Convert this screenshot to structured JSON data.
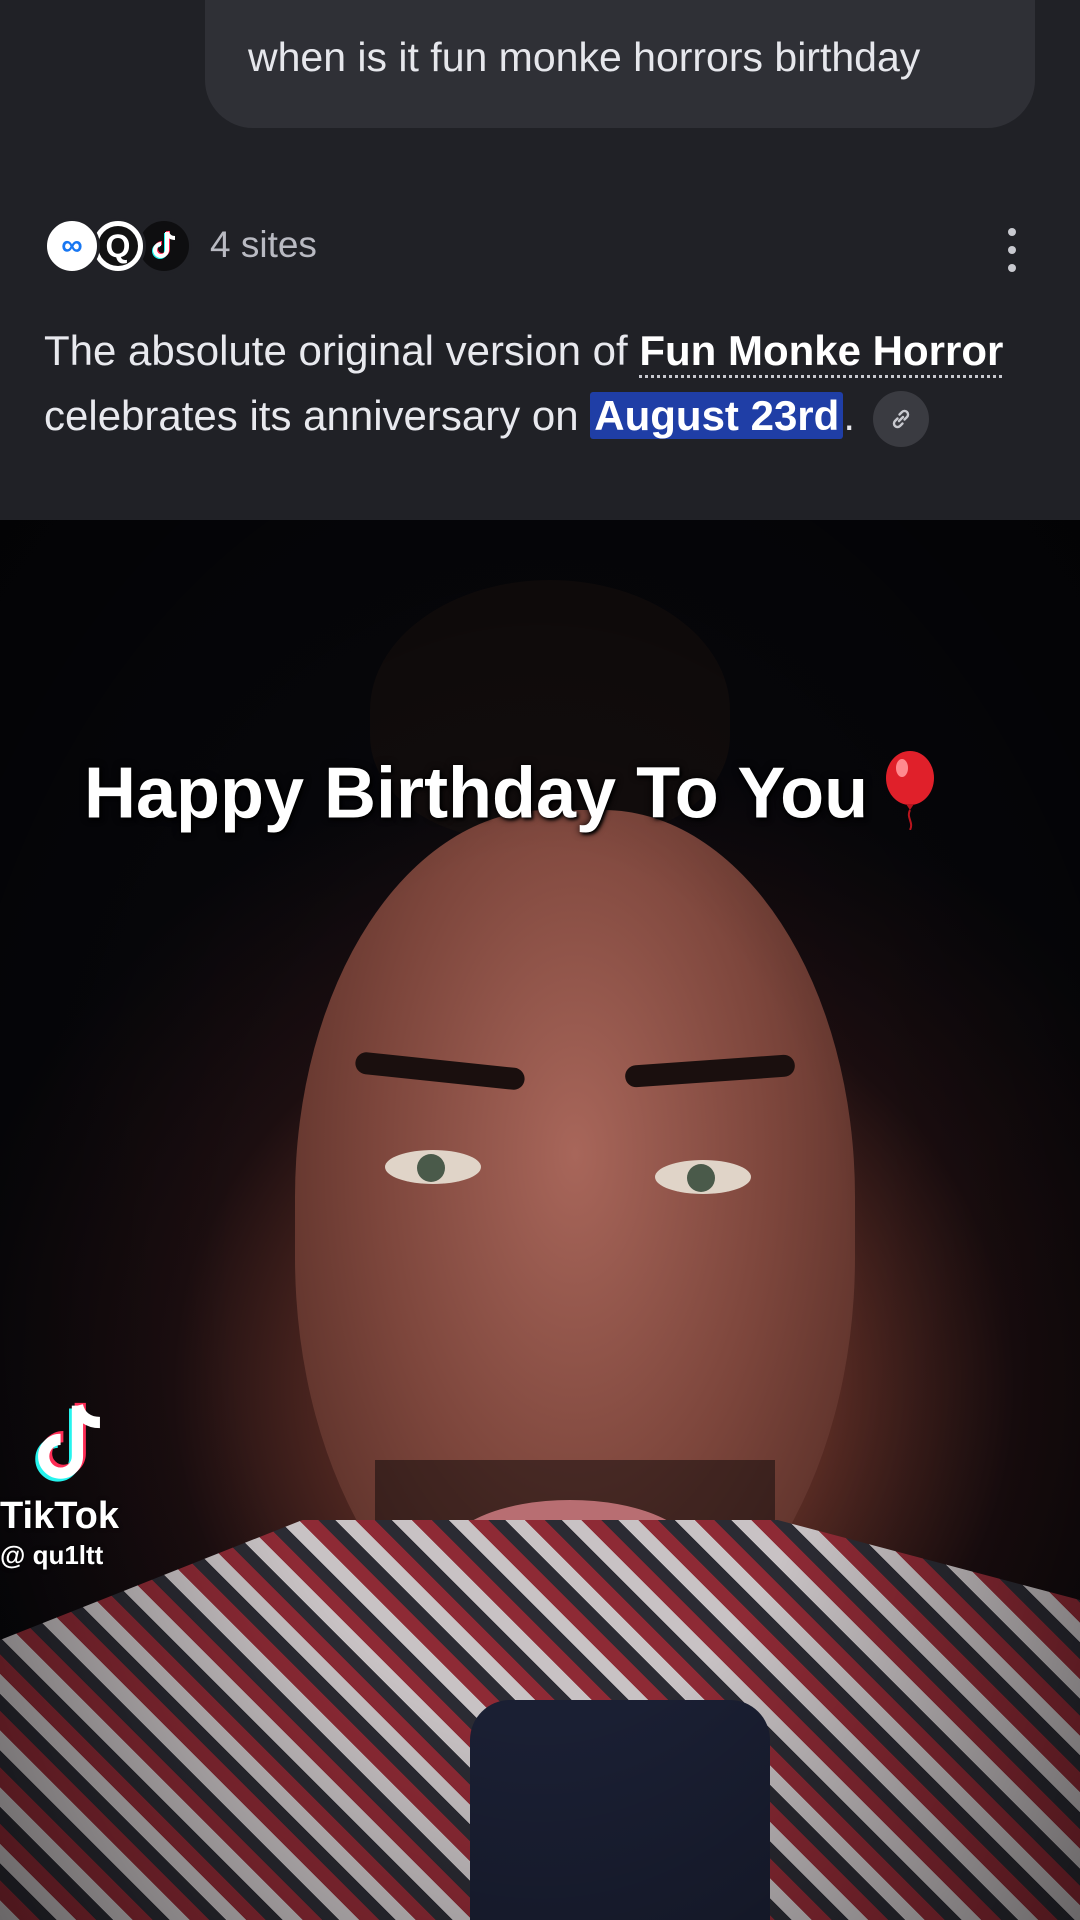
{
  "query": {
    "text": "when is it fun monke horrors birthday"
  },
  "sources": {
    "label": "4 sites",
    "icons": [
      "meta-icon",
      "quora-icon",
      "tiktok-icon"
    ]
  },
  "answer": {
    "part1": "The absolute original version of ",
    "keyword": "Fun Monke Horror",
    "part2": " celebrates its anniversary on ",
    "date": "August 23rd",
    "part3": "."
  },
  "video": {
    "caption": "Happy Birthday To You",
    "brand": "TikTok",
    "username": "@ qu1ltt"
  },
  "colors": {
    "background": "#202126",
    "bubble": "#2f3036",
    "highlight": "#1f3ea6"
  }
}
